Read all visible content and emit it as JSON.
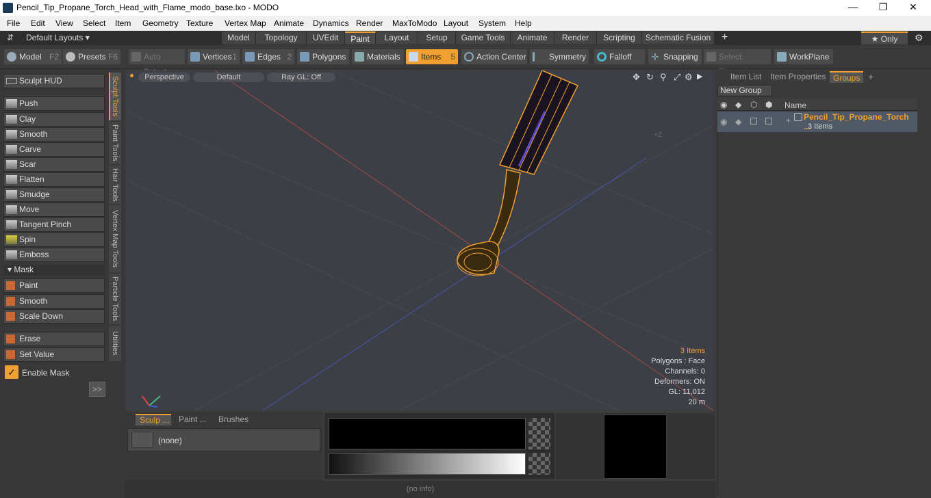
{
  "window": {
    "title": "Pencil_Tip_Propane_Torch_Head_with_Flame_modo_base.lxo - MODO",
    "minimize": "—",
    "maximize": "❐",
    "close": "✕"
  },
  "menu": [
    "File",
    "Edit",
    "View",
    "Select",
    "Item",
    "Geometry",
    "Texture",
    "Vertex Map",
    "Animate",
    "Dynamics",
    "Render",
    "MaxToModo",
    "Layout",
    "System",
    "Help"
  ],
  "layoutbar": {
    "layouts": "Default Layouts ▾",
    "tabs": [
      "Model",
      "Topology",
      "UVEdit",
      "Paint",
      "Layout",
      "Setup",
      "Game Tools",
      "Animate",
      "Render",
      "Scripting",
      "Schematic Fusion"
    ],
    "add": "+",
    "only": "★  Only",
    "gear": "⚙"
  },
  "toolbar": {
    "model": "Model",
    "model_key": "F2",
    "presets": "Presets",
    "presets_key": "F6",
    "auto_select": "Auto Select",
    "vertices": "Vertices",
    "vertices_key": "1",
    "edges": "Edges",
    "edges_key": "2",
    "polygons": "Polygons",
    "materials": "Materials",
    "items": "Items",
    "items_key": "5",
    "action_center": "Action Center",
    "symmetry": "Symmetry",
    "falloff": "Falloff",
    "snapping": "Snapping",
    "select_through": "Select Through",
    "workplane": "WorkPlane"
  },
  "sculpt": {
    "hud": "Sculpt HUD",
    "tools": [
      "Push",
      "Clay",
      "Smooth",
      "Carve",
      "Scar",
      "Flatten",
      "Smudge",
      "Move",
      "Tangent Pinch",
      "Spin",
      "Emboss"
    ],
    "mask_header": "Mask",
    "mask_tools": [
      "Paint",
      "Smooth",
      "Scale Down"
    ],
    "erase": "Erase",
    "set_value": "Set Value",
    "enable_mask": "Enable Mask",
    "more": ">>"
  },
  "vtabs": [
    "Sculpt Tools",
    "Paint Tools",
    "Hair Tools",
    "Vertex Map Tools",
    "Particle Tools",
    "Utilities"
  ],
  "viewport": {
    "view": "Perspective",
    "shading": "Default",
    "render": "Ray GL: Off",
    "axis_label": "+Z",
    "stats": {
      "items": "3 Items",
      "polygons": "Polygons : Face",
      "channels": "Channels: 0",
      "deformers": "Deformers: ON",
      "gl": "GL: 11,012",
      "scale": "20 m"
    }
  },
  "brushpanel": {
    "tabs": [
      "Sculp ...",
      "Paint ...",
      "Brushes"
    ],
    "preset": "(none)"
  },
  "status": "(no info)",
  "rightpanel": {
    "tabs": [
      "Item List",
      "Item Properties",
      "Groups"
    ],
    "new_group": "New Group",
    "name_header": "Name",
    "group_name": "Pencil_Tip_Propane_Torch ...",
    "group_count": "3 Items"
  }
}
